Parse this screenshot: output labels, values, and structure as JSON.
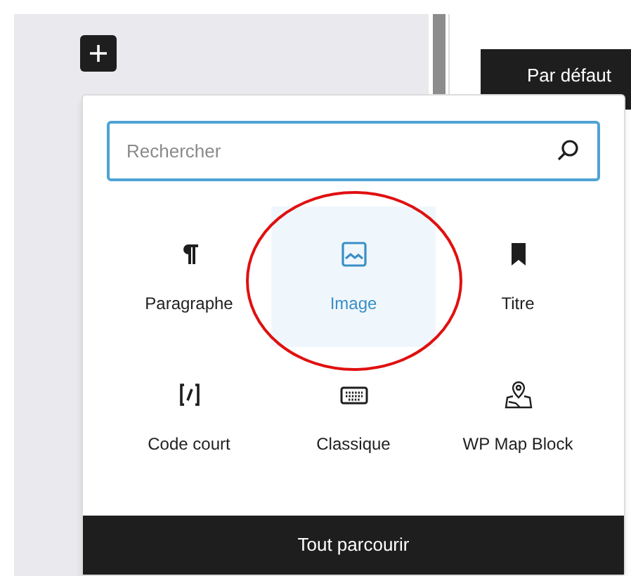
{
  "toolbar_button": {
    "label": "Par défaut"
  },
  "inserter": {
    "search": {
      "placeholder": "Rechercher"
    },
    "blocks": [
      {
        "label": "Paragraphe",
        "kind": "paragraph",
        "selected": false
      },
      {
        "label": "Image",
        "kind": "image",
        "selected": true
      },
      {
        "label": "Titre",
        "kind": "heading",
        "selected": false
      },
      {
        "label": "Code court",
        "kind": "shortcode",
        "selected": false
      },
      {
        "label": "Classique",
        "kind": "classic",
        "selected": false
      },
      {
        "label": "WP Map Block",
        "kind": "map",
        "selected": false
      }
    ],
    "browse_all": "Tout parcourir"
  }
}
